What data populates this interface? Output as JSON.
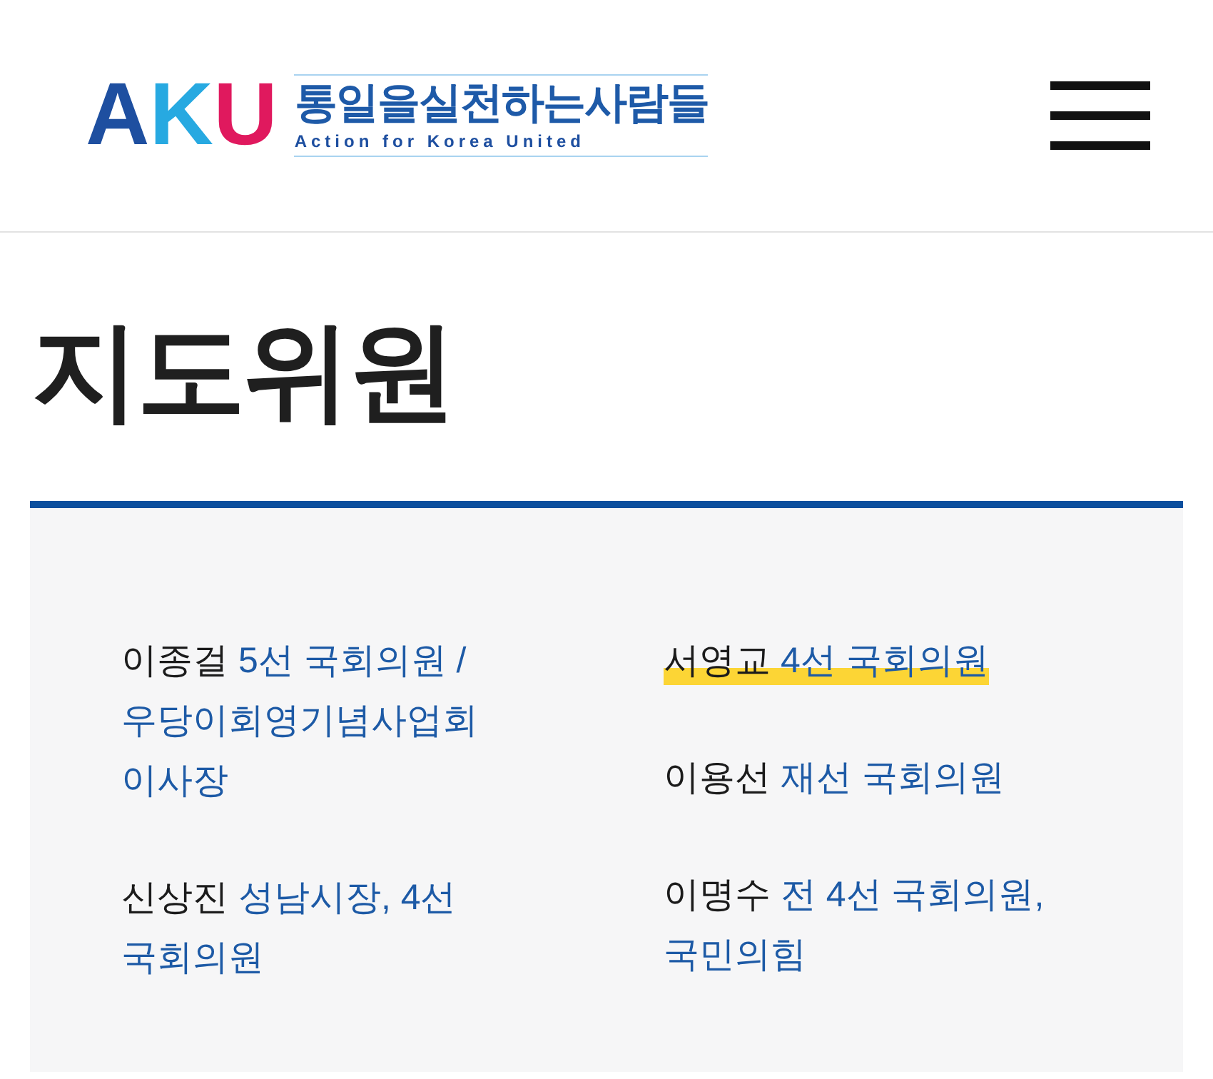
{
  "header": {
    "logo": {
      "letters": [
        {
          "text": "A",
          "color": "#1e4fa0"
        },
        {
          "text": "K",
          "color": "#27a9e1"
        },
        {
          "text": "U",
          "color": "#e0195e"
        }
      ],
      "name": "통일을실천하는사람들",
      "tagline": "Action for Korea United"
    }
  },
  "page_title": "지도위원",
  "columns": [
    [
      {
        "name": "이종걸",
        "role": "5선 국회의원 / 우당이회영기념사업회 이사장",
        "highlighted": false
      },
      {
        "name": "신상진",
        "role": "성남시장, 4선 국회의원",
        "highlighted": false
      }
    ],
    [
      {
        "name": "서영교",
        "role": "4선 국회의원",
        "highlighted": true
      },
      {
        "name": "이용선",
        "role": "재선 국회의원",
        "highlighted": false
      },
      {
        "name": "이명수",
        "role": "전 4선 국회의원, 국민의힘",
        "highlighted": false
      }
    ]
  ]
}
